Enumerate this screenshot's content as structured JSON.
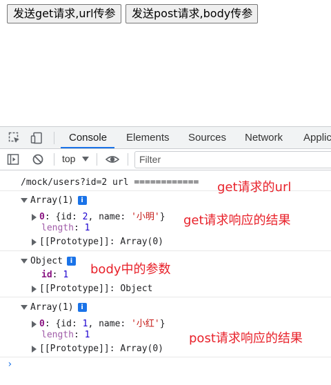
{
  "page": {
    "buttons": {
      "get_label": "发送get请求,url传参",
      "post_label": "发送post请求,body传参"
    }
  },
  "devtools": {
    "tabs": [
      "Console",
      "Elements",
      "Sources",
      "Network",
      "Applic"
    ],
    "active_tab": "Console",
    "toolbar": {
      "context": "top",
      "filter_placeholder": "Filter"
    },
    "icons": [
      "inspect-element-icon",
      "device-toolbar-icon",
      "sidebar-toggle-icon",
      "clear-console-icon",
      "dropdown-caret-icon",
      "eye-icon"
    ],
    "accent_color": "#1a73e8"
  },
  "console": {
    "log1": "/mock/users?id=2 url ============",
    "msg1": {
      "header": "Array(1)",
      "item_index": "0",
      "item_text_prefix": "{id: ",
      "item_id": "2",
      "item_name_sep": ", name: ",
      "item_name": "'小明'",
      "item_close": "}",
      "length_key": "length",
      "length_val": "1",
      "proto": "[[Prototype]]: Array(0)"
    },
    "msg2": {
      "header": "Object",
      "id_key": "id",
      "id_val": "1",
      "proto": "[[Prototype]]: Object"
    },
    "msg3": {
      "header": "Array(1)",
      "item_index": "0",
      "item_text_prefix": "{id: ",
      "item_id": "1",
      "item_name_sep": ", name: ",
      "item_name": "'小红'",
      "item_close": "}",
      "length_key": "length",
      "length_val": "1",
      "proto": "[[Prototype]]: Array(0)"
    },
    "prompt": "›",
    "info_badge": "i"
  },
  "annotations": {
    "a1": "get请求的url",
    "a2": "get请求响应的结果",
    "a3": "body中的参数",
    "a4": "post请求响应的结果",
    "color": "#e8212a"
  }
}
